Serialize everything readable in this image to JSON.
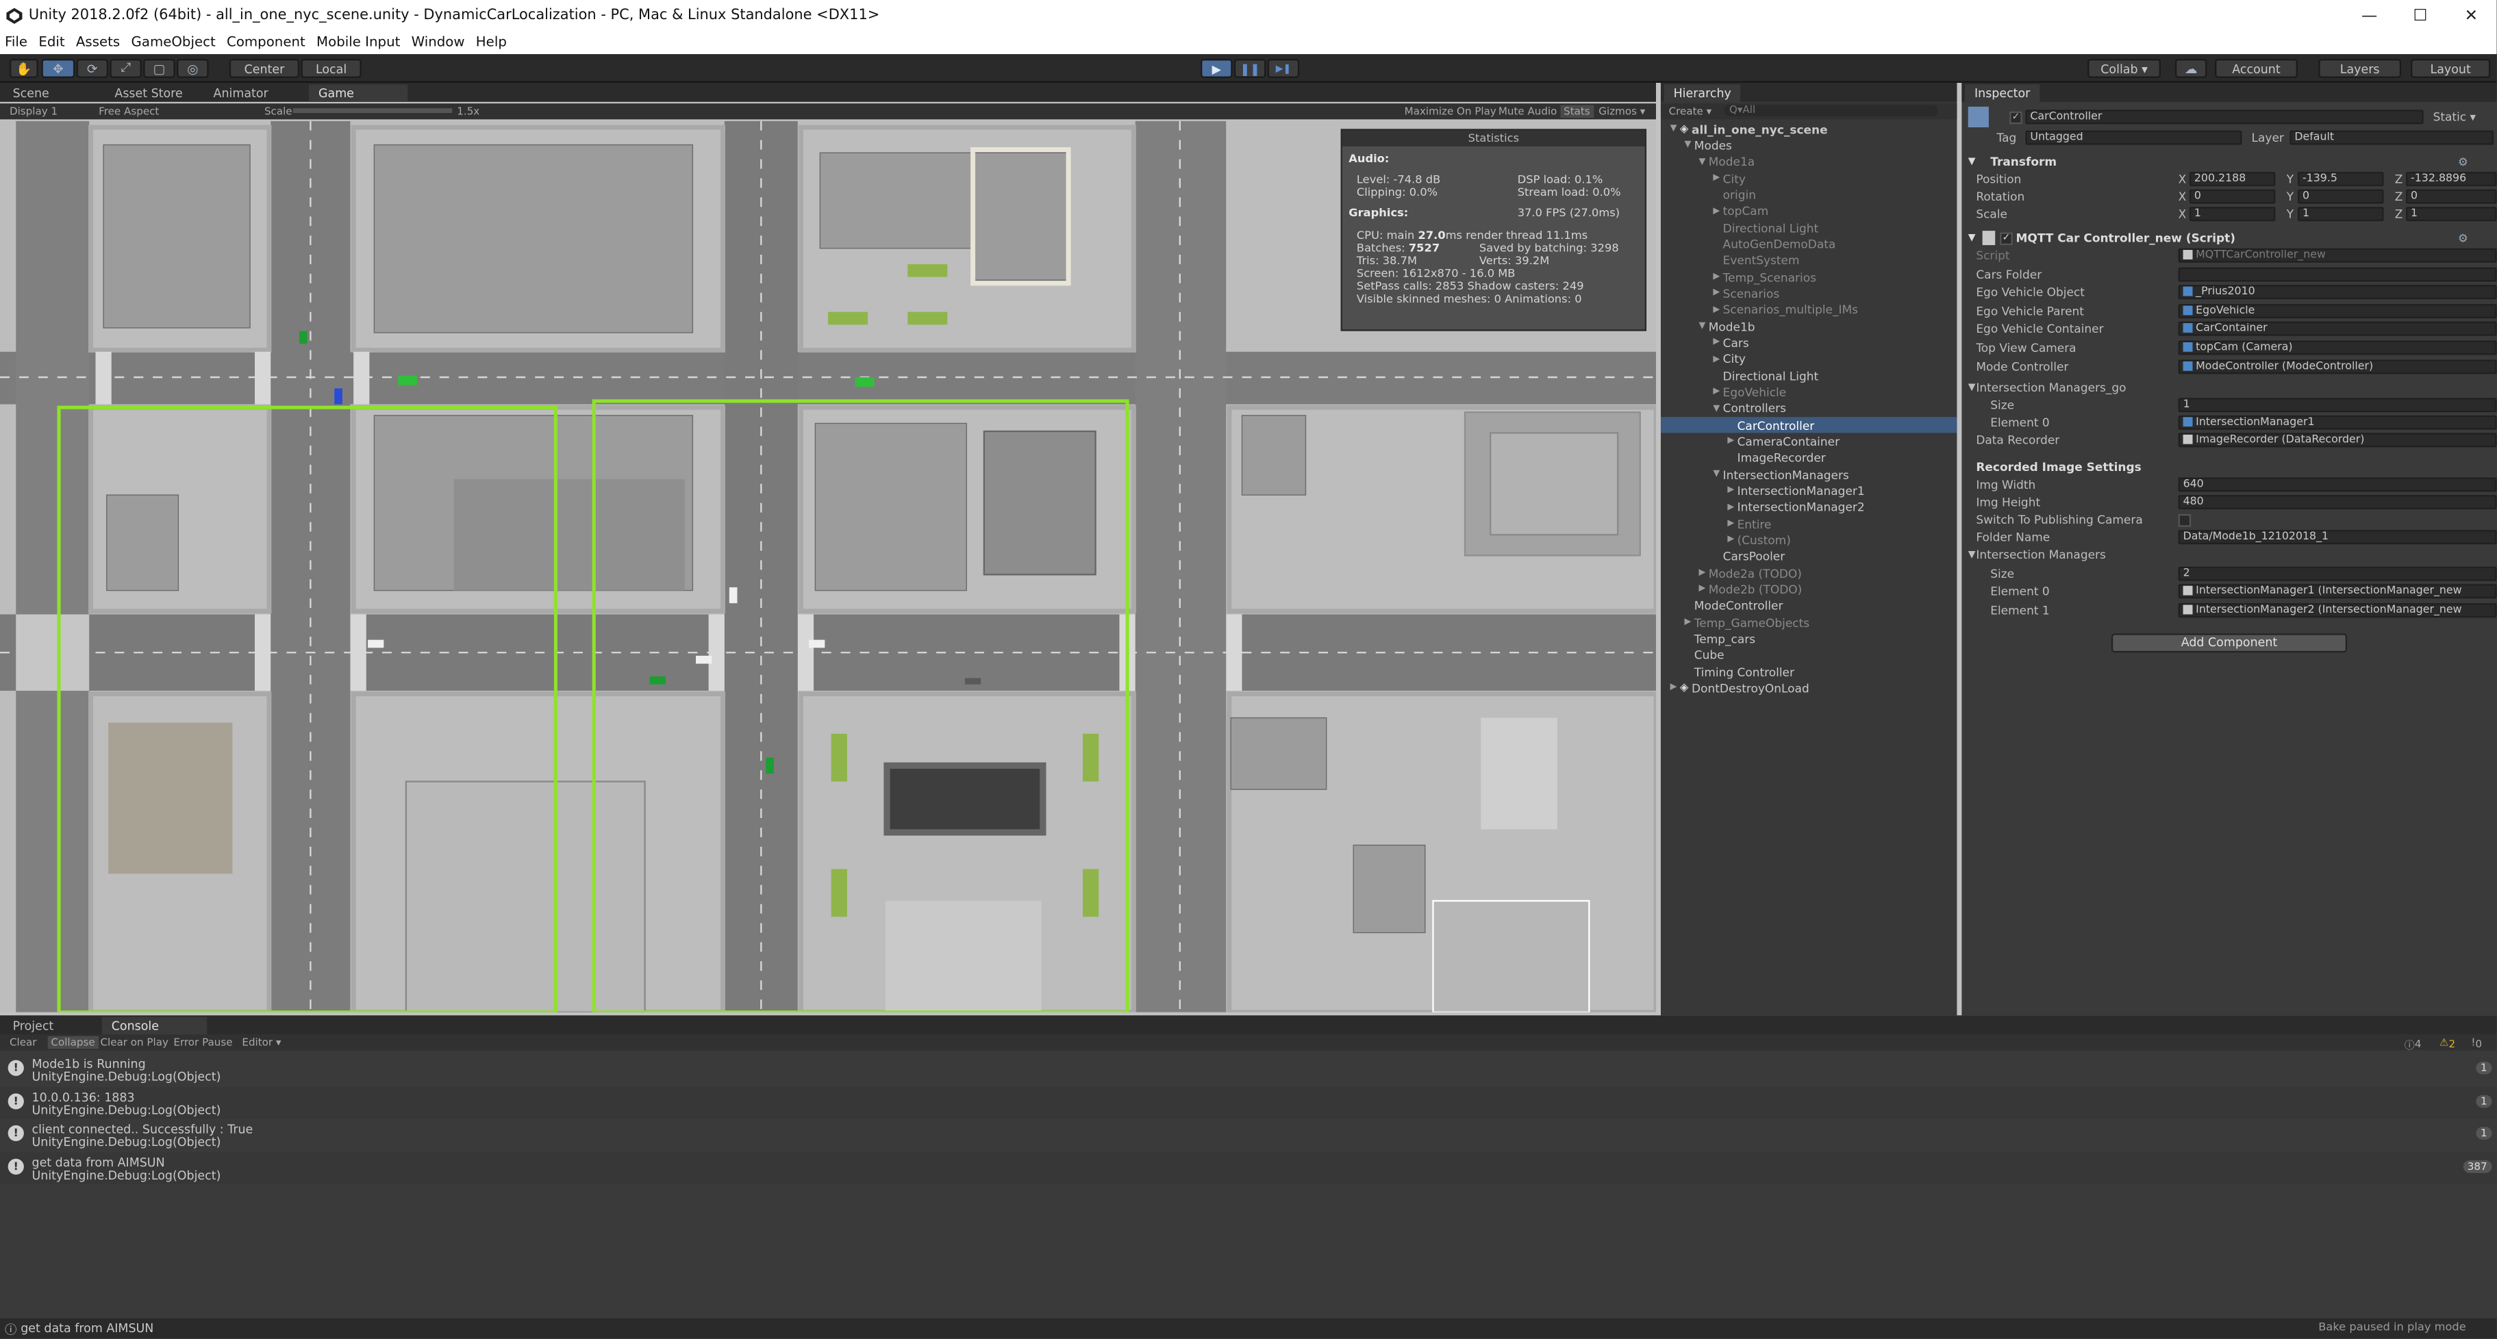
{
  "window": {
    "title": "Unity 2018.2.0f2 (64bit) - all_in_one_nyc_scene.unity - DynamicCarLocalization - PC, Mac & Linux Standalone <DX11>",
    "minimize_glyph": "—",
    "maximize_glyph": "☐",
    "close_glyph": "✕"
  },
  "menu": [
    "File",
    "Edit",
    "Assets",
    "GameObject",
    "Component",
    "Mobile Input",
    "Window",
    "Help"
  ],
  "toolbar": {
    "pivot_label": "Center",
    "space_label": "Local",
    "collab_label": "Collab ▾",
    "account_label": "Account",
    "layers_label": "Layers",
    "layout_label": "Layout",
    "play_glyph": "▶",
    "pause_glyph": "❚❚",
    "step_glyph": "▶❚"
  },
  "view_tabs": [
    "Scene",
    "Asset Store",
    "Animator",
    "Game"
  ],
  "game_controls": {
    "display": "Display 1",
    "aspect": "Free Aspect",
    "scale_label": "Scale",
    "scale_value": "1.5x",
    "maximize": "Maximize On Play",
    "mute": "Mute Audio",
    "stats": "Stats",
    "gizmos": "Gizmos ▾"
  },
  "statistics": {
    "header": "Statistics",
    "audio_label": "Audio:",
    "level": "Level: -74.8 dB",
    "clipping": "Clipping: 0.0%",
    "dsp_load": "DSP load: 0.1%",
    "stream_load": "Stream load: 0.0%",
    "graphics_label": "Graphics:",
    "fps": "37.0 FPS (27.0ms)",
    "cpu_prefix": "CPU: main",
    "cpu_main": "27.0",
    "cpu_suffix": "ms  render thread 11.1ms",
    "batches_prefix": "Batches:",
    "batches": "7527",
    "saved_by_batching": "Saved by batching: 3298",
    "tris": "Tris: 38.7M",
    "verts": "Verts: 39.2M",
    "screen": "Screen: 1612x870 - 16.0 MB",
    "setpass": "SetPass calls: 2853   Shadow casters: 249",
    "skinned": "Visible skinned meshes: 0   Animations: 0"
  },
  "hierarchy": {
    "tab": "Hierarchy",
    "create": "Create ▾",
    "search_placeholder": "Q▾All",
    "rows": [
      {
        "label": "all_in_one_nyc_scene",
        "indent": 0,
        "arrow": "▼",
        "bold": true,
        "scene": true
      },
      {
        "label": "Modes",
        "indent": 1,
        "arrow": "▼"
      },
      {
        "label": "Mode1a",
        "indent": 2,
        "arrow": "▼",
        "dim": true
      },
      {
        "label": "City",
        "indent": 3,
        "arrow": "▶",
        "dim": true
      },
      {
        "label": "origin",
        "indent": 3,
        "arrow": "",
        "dim": true
      },
      {
        "label": "topCam",
        "indent": 3,
        "arrow": "▶",
        "dim": true
      },
      {
        "label": "Directional Light",
        "indent": 3,
        "arrow": "",
        "dim": true
      },
      {
        "label": "AutoGenDemoData",
        "indent": 3,
        "arrow": "",
        "dim": true
      },
      {
        "label": "EventSystem",
        "indent": 3,
        "arrow": "",
        "dim": true
      },
      {
        "label": "Temp_Scenarios",
        "indent": 3,
        "arrow": "▶",
        "dim": true
      },
      {
        "label": "Scenarios",
        "indent": 3,
        "arrow": "▶",
        "dim": true
      },
      {
        "label": "Scenarios_multiple_IMs",
        "indent": 3,
        "arrow": "▶",
        "dim": true
      },
      {
        "label": "Mode1b",
        "indent": 2,
        "arrow": "▼"
      },
      {
        "label": "Cars",
        "indent": 3,
        "arrow": "▶"
      },
      {
        "label": "City",
        "indent": 3,
        "arrow": "▶"
      },
      {
        "label": "Directional Light",
        "indent": 3,
        "arrow": ""
      },
      {
        "label": "EgoVehicle",
        "indent": 3,
        "arrow": "▶",
        "dim": true
      },
      {
        "label": "Controllers",
        "indent": 3,
        "arrow": "▼"
      },
      {
        "label": "CarController",
        "indent": 4,
        "arrow": "",
        "selected": true
      },
      {
        "label": "CameraContainer",
        "indent": 4,
        "arrow": "▶"
      },
      {
        "label": "ImageRecorder",
        "indent": 4,
        "arrow": ""
      },
      {
        "label": "IntersectionManagers",
        "indent": 3,
        "arrow": "▼"
      },
      {
        "label": "IntersectionManager1",
        "indent": 4,
        "arrow": "▶"
      },
      {
        "label": "IntersectionManager2",
        "indent": 4,
        "arrow": "▶"
      },
      {
        "label": "Entire",
        "indent": 4,
        "arrow": "▶",
        "dim": true
      },
      {
        "label": "(Custom)",
        "indent": 4,
        "arrow": "▶",
        "dim": true
      },
      {
        "label": "CarsPooler",
        "indent": 3,
        "arrow": ""
      },
      {
        "label": "Mode2a (TODO)",
        "indent": 2,
        "arrow": "▶",
        "dim": true
      },
      {
        "label": "Mode2b (TODO)",
        "indent": 2,
        "arrow": "▶",
        "dim": true
      },
      {
        "label": "ModeController",
        "indent": 1,
        "arrow": ""
      },
      {
        "label": "Temp_GameObjects",
        "indent": 1,
        "arrow": "▶",
        "dim": true
      },
      {
        "label": "Temp_cars",
        "indent": 1,
        "arrow": ""
      },
      {
        "label": "Cube",
        "indent": 1,
        "arrow": ""
      },
      {
        "label": "Timing Controller",
        "indent": 1,
        "arrow": ""
      },
      {
        "label": "DontDestroyOnLoad",
        "indent": 0,
        "arrow": "▶",
        "scene": true
      }
    ]
  },
  "inspector": {
    "tab": "Inspector",
    "object_name": "CarController",
    "static_label": "Static ▾",
    "tag_label": "Tag",
    "tag_value": "Untagged",
    "layer_label": "Layer",
    "layer_value": "Default",
    "transform": {
      "header": "Transform",
      "position_label": "Position",
      "rotation_label": "Rotation",
      "scale_label": "Scale",
      "pos": {
        "x": "200.2188",
        "y": "-139.5",
        "z": "-132.8896"
      },
      "rot": {
        "x": "0",
        "y": "0",
        "z": "0"
      },
      "scl": {
        "x": "1",
        "y": "1",
        "z": "1"
      }
    },
    "script_component": {
      "header": "MQTT Car Controller_new (Script)",
      "fields": [
        {
          "label": "Script",
          "value": "MQTTCarController_new",
          "dim": true
        },
        {
          "label": "Cars Folder",
          "value": ""
        },
        {
          "label": "Ego Vehicle Object",
          "value": "_Prius2010"
        },
        {
          "label": "Ego Vehicle Parent",
          "value": "EgoVehicle"
        },
        {
          "label": "Ego Vehicle Container",
          "value": "CarContainer"
        },
        {
          "label": "Top View Camera",
          "value": "topCam (Camera)"
        },
        {
          "label": "Mode Controller",
          "value": "ModeController (ModeController)"
        }
      ],
      "im_go_label": "Intersection Managers_go",
      "im_go_size_label": "Size",
      "im_go_size": "1",
      "im_go_el0_label": "Element 0",
      "im_go_el0": "IntersectionManager1",
      "data_recorder_label": "Data Recorder",
      "data_recorder": "ImageRecorder (DataRecorder)",
      "recorded_header": "Recorded Image Settings",
      "img_width_label": "Img Width",
      "img_width": "640",
      "img_height_label": "Img Height",
      "img_height": "480",
      "switch_label": "Switch To Publishing Camera",
      "folder_label": "Folder Name",
      "folder": "Data/Mode1b_12102018_1",
      "im_label": "Intersection Managers",
      "im_size_label": "Size",
      "im_size": "2",
      "im_el0_label": "Element 0",
      "im_el0": "IntersectionManager1 (IntersectionManager_new",
      "im_el1_label": "Element 1",
      "im_el1": "IntersectionManager2 (IntersectionManager_new"
    },
    "add_component": "Add Component"
  },
  "console": {
    "tabs": [
      "Project",
      "Console"
    ],
    "toolbar": [
      "Clear",
      "Collapse",
      "Clear on Play",
      "Error Pause",
      "Editor ▾"
    ],
    "counts": {
      "info": "4",
      "warning": "2",
      "error": "0"
    },
    "entries": [
      {
        "line1": "Mode1b is Running",
        "line2": "UnityEngine.Debug:Log(Object)",
        "count": "1"
      },
      {
        "line1": "10.0.0.136: 1883",
        "line2": "UnityEngine.Debug:Log(Object)",
        "count": "1"
      },
      {
        "line1": "client connected.. Successfully : True",
        "line2": "UnityEngine.Debug:Log(Object)",
        "count": "1"
      },
      {
        "line1": "get data from AIMSUN",
        "line2": "UnityEngine.Debug:Log(Object)",
        "count": "387"
      }
    ]
  },
  "status": {
    "message": "get data from AIMSUN",
    "bake": "Bake paused in play mode"
  },
  "colors": {
    "accent_selection": "#3d5a80",
    "play_active": "#4b6e9c",
    "route_green": "#8fe22a"
  }
}
